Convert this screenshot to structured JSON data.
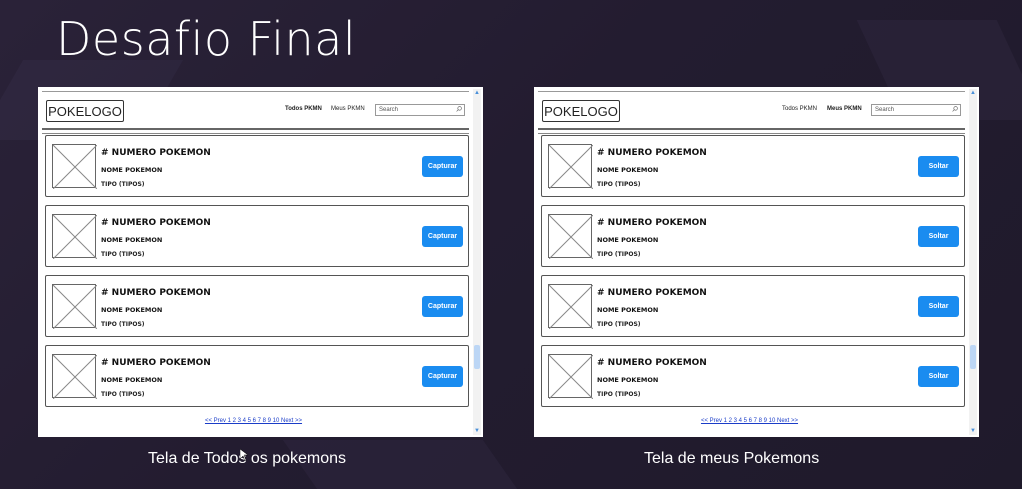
{
  "slide": {
    "title": "Desafio Final"
  },
  "left_panel": {
    "logo": "POKELOGO",
    "nav_todos": "Todos PKMN",
    "nav_meus": "Meus PKMN",
    "active_nav": "Todos PKMN",
    "search_placeholder": "Search",
    "cards": [
      {
        "numero": "# NUMERO POKEMON",
        "nome": "NOME POKEMON",
        "tipo": "TIPO (TIPOS)",
        "button": "Capturar"
      },
      {
        "numero": "# NUMERO POKEMON",
        "nome": "NOME POKEMON",
        "tipo": "TIPO (TIPOS)",
        "button": "Capturar"
      },
      {
        "numero": "# NUMERO POKEMON",
        "nome": "NOME POKEMON",
        "tipo": "TIPO (TIPOS)",
        "button": "Capturar"
      },
      {
        "numero": "# NUMERO POKEMON",
        "nome": "NOME POKEMON",
        "tipo": "TIPO (TIPOS)",
        "button": "Capturar"
      }
    ],
    "pagination": "<< Prev 1 2 3 4 5 6 7 8 9 10 Next >>",
    "caption": "Tela de Todos os pokemons"
  },
  "right_panel": {
    "logo": "POKELOGO",
    "nav_todos": "Todos PKMN",
    "nav_meus": "Meus PKMN",
    "active_nav": "Meus PKMN",
    "search_placeholder": "Search",
    "cards": [
      {
        "numero": "# NUMERO POKEMON",
        "nome": "NOME POKEMON",
        "tipo": "TIPO (TIPOS)",
        "button": "Soltar"
      },
      {
        "numero": "# NUMERO POKEMON",
        "nome": "NOME POKEMON",
        "tipo": "TIPO (TIPOS)",
        "button": "Soltar"
      },
      {
        "numero": "# NUMERO POKEMON",
        "nome": "NOME POKEMON",
        "tipo": "TIPO (TIPOS)",
        "button": "Soltar"
      },
      {
        "numero": "# NUMERO POKEMON",
        "nome": "NOME POKEMON",
        "tipo": "TIPO (TIPOS)",
        "button": "Soltar"
      }
    ],
    "pagination": "<< Prev 1 2 3 4 5 6 7 8 9 10 Next >>",
    "caption": "Tela de meus Pokemons"
  },
  "colors": {
    "button_blue": "#1a8cf0",
    "link_blue": "#1a3cc8",
    "background": "#241d31"
  }
}
